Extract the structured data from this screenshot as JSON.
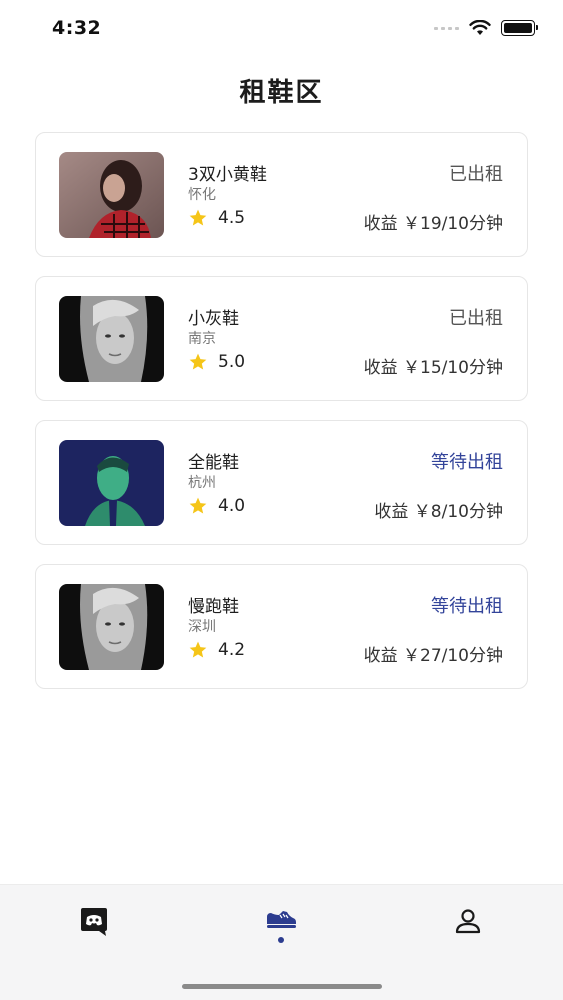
{
  "status_bar": {
    "time": "4:32"
  },
  "page": {
    "title": "租鞋区"
  },
  "shoes": [
    {
      "name": "3双小黄鞋",
      "city": "怀化",
      "rating": "4.5",
      "status": "已出租",
      "status_type": "rented",
      "income": "收益 ￥19/10分钟",
      "photo_icon": "portrait-photo-red-scarf"
    },
    {
      "name": "小灰鞋",
      "city": "南京",
      "rating": "5.0",
      "status": "已出租",
      "status_type": "rented",
      "income": "收益 ￥15/10分钟",
      "photo_icon": "portrait-photo-grayscale"
    },
    {
      "name": "全能鞋",
      "city": "杭州",
      "rating": "4.0",
      "status": "等待出租",
      "status_type": "pending",
      "income": "收益 ￥8/10分钟",
      "photo_icon": "portrait-photo-teal"
    },
    {
      "name": "慢跑鞋",
      "city": "深圳",
      "rating": "4.2",
      "status": "等待出租",
      "status_type": "pending",
      "income": "收益 ￥27/10分钟",
      "photo_icon": "portrait-photo-grayscale"
    }
  ],
  "tab_bar": {
    "tabs": [
      {
        "icon": "chat-bubble-icon",
        "active": false
      },
      {
        "icon": "sneaker-icon",
        "active": true
      },
      {
        "icon": "person-icon",
        "active": false
      }
    ]
  },
  "colors": {
    "pending_status": "#33449a",
    "rented_status": "#555555",
    "star": "#f5c518",
    "active_tab": "#2c3c8f"
  }
}
